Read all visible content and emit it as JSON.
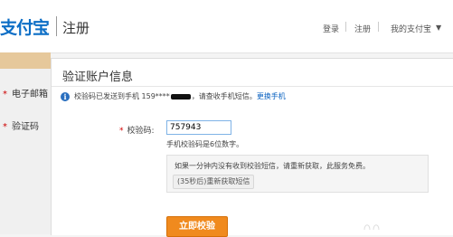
{
  "header": {
    "logo_text": "支付宝",
    "title": "注册",
    "nav": [
      "登录",
      "注册",
      "我的支付宝"
    ]
  },
  "sidebar": {
    "items": [
      {
        "label": "电子邮箱"
      },
      {
        "label": "验证码"
      }
    ]
  },
  "dialog": {
    "title": "验证账户信息",
    "notice_prefix": "校验码已发送到手机 159****",
    "notice_suffix": "，请查收手机短信。",
    "notice_link": "更换手机",
    "field_label": "校验码:",
    "code_value": "757943",
    "hint": "手机校验码是6位数字。",
    "box_text": "如果一分钟内没有收到校验短信，请重新获取，此服务免费。",
    "resend_label": "(35秒后)重新获取短信",
    "submit_label": "立即校验"
  },
  "colors": {
    "brand": "#0c6ec6",
    "accent_orange": "#f08a1e",
    "link": "#0a62c0",
    "required": "#d40000"
  }
}
